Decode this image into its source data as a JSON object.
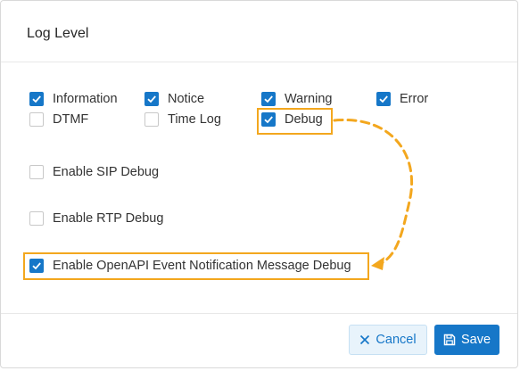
{
  "dialog": {
    "title": "Log Level"
  },
  "log_types": [
    {
      "label": "Information",
      "checked": true
    },
    {
      "label": "Notice",
      "checked": true
    },
    {
      "label": "Warning",
      "checked": true
    },
    {
      "label": "Error",
      "checked": true
    },
    {
      "label": "DTMF",
      "checked": false
    },
    {
      "label": "Time Log",
      "checked": false
    },
    {
      "label": "Debug",
      "checked": true
    }
  ],
  "options": [
    {
      "label": "Enable SIP Debug",
      "checked": false
    },
    {
      "label": "Enable RTP Debug",
      "checked": false
    },
    {
      "label": "Enable OpenAPI Event Notification Message Debug",
      "checked": true
    }
  ],
  "footer": {
    "cancel_label": "Cancel",
    "save_label": "Save"
  },
  "colors": {
    "accent": "#1677c8",
    "highlight": "#f3a71e"
  }
}
